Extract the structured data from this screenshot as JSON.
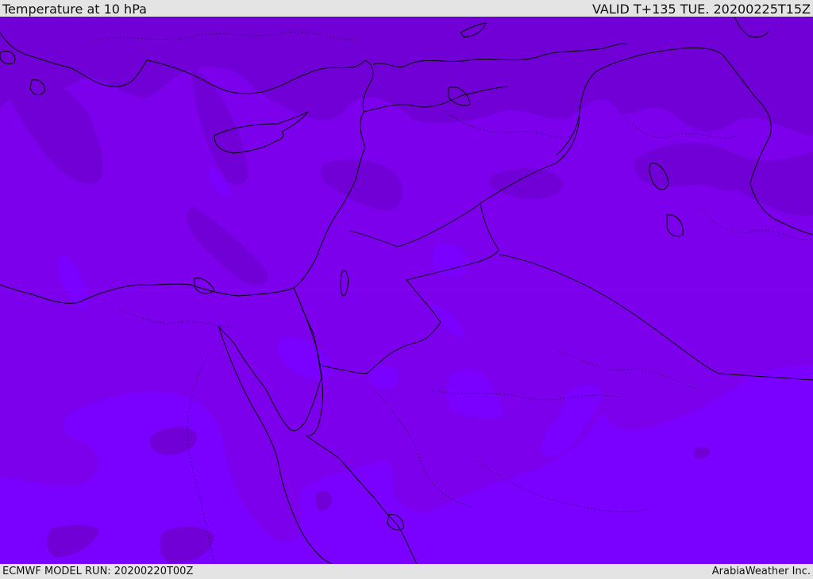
{
  "header": {
    "title": "Temperature at 10 hPa",
    "valid_time": "VALID T+135 TUE. 20200225T15Z"
  },
  "footer": {
    "model_run": "ECMWF MODEL RUN: 20200220T00Z",
    "credit": "ArabiaWeather Inc."
  },
  "map": {
    "colors": {
      "cold_band": "#7100d6",
      "mid_band": "#7c00ec",
      "warm_band": "#7a00ff",
      "warmest_patch": "#7e1aff",
      "coastline": "#000000"
    }
  }
}
